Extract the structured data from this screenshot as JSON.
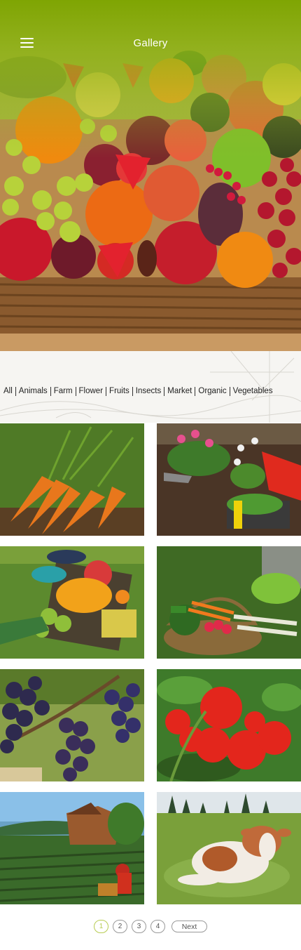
{
  "header": {
    "title": "Gallery",
    "menu_icon": "hamburger-menu-icon",
    "accent_color": "#7fa600"
  },
  "filters": [
    "All",
    "Animals",
    "Farm",
    "Flower",
    "Fruits",
    "Insects",
    "Market",
    "Organic",
    "Vegetables"
  ],
  "gallery": [
    {
      "subject": "carrots"
    },
    {
      "subject": "gardening-flowers"
    },
    {
      "subject": "market-produce"
    },
    {
      "subject": "vegetable-basket"
    },
    {
      "subject": "grapes"
    },
    {
      "subject": "tomatoes"
    },
    {
      "subject": "farmhouse-field"
    },
    {
      "subject": "cow-on-grass"
    }
  ],
  "pagination": {
    "pages": [
      "1",
      "2",
      "3",
      "4"
    ],
    "current": "1",
    "next_label": "Next",
    "active_color": "#b7cc52"
  }
}
